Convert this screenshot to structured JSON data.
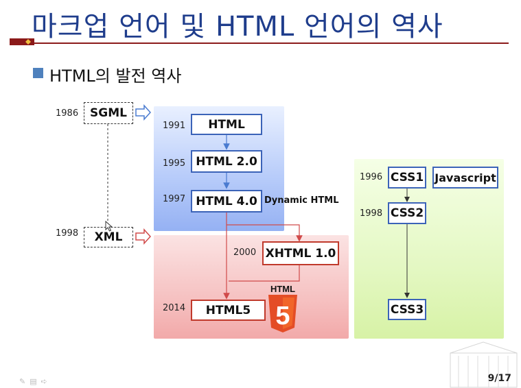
{
  "slide": {
    "title": "마크업 언어 및 HTML 언어의 역사",
    "subtitle": "HTML의 발전 역사",
    "page_number": "9/17",
    "bullet_color": "#4f81bd",
    "title_color": "#1f3d8c"
  },
  "diagram": {
    "sgml": {
      "year": "1986",
      "label": "SGML"
    },
    "xml": {
      "year": "1998",
      "label": "XML"
    },
    "html_timeline": [
      {
        "year": "1991",
        "label": "HTML"
      },
      {
        "year": "1995",
        "label": "HTML 2.0"
      },
      {
        "year": "1997",
        "label": "HTML 4.0"
      }
    ],
    "dynamic_html_note": "Dynamic HTML",
    "xhtml": {
      "year": "2000",
      "label": "XHTML 1.0"
    },
    "html5": {
      "year": "2014",
      "label": "HTML5"
    },
    "html5_logo_text": "HTML",
    "html5_logo_digit": "5",
    "css": [
      {
        "year": "1996",
        "label": "CSS1"
      },
      {
        "year": "1998",
        "label": "CSS2"
      },
      {
        "year": "",
        "label": "CSS3"
      }
    ],
    "javascript": {
      "label": "Javascript"
    },
    "colors": {
      "blue_border": "#3b63b8",
      "red_border": "#c0392b",
      "blue_arrow": "#4a7bd0",
      "red_arrow": "#d04a4a"
    }
  }
}
